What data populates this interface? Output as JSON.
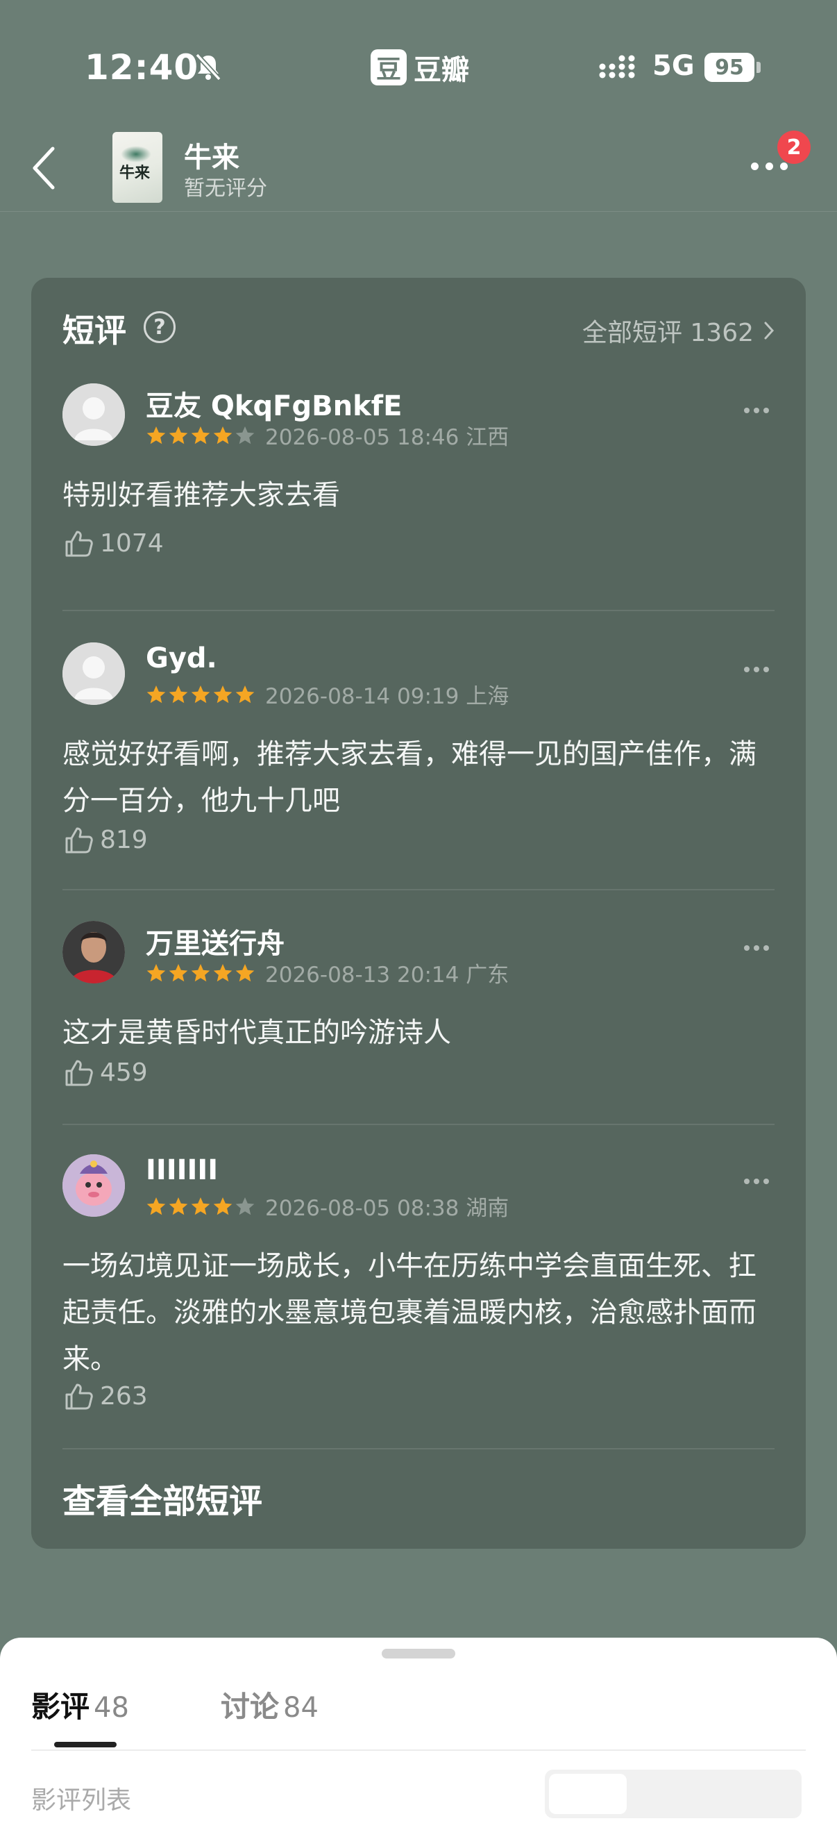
{
  "status_bar": {
    "time": "12:40",
    "network": "5G",
    "battery": "95",
    "app_logo": "豆",
    "app_name": "豆瓣"
  },
  "header": {
    "title": "牛来",
    "rating": "暂无评分",
    "notification_count": "2",
    "poster_text": "牛来"
  },
  "card": {
    "title": "短评",
    "help_symbol": "?",
    "all_link": "全部短评 1362",
    "view_all": "查看全部短评"
  },
  "reviews": [
    {
      "user": "豆友 QkqFgBnkfE",
      "stars": 4,
      "date": "2026-08-05 18:46 江西",
      "content": "特别好看推荐大家去看",
      "likes": "1074",
      "avatar": "default"
    },
    {
      "user": "Gyd.",
      "stars": 5,
      "date": "2026-08-14 09:19 上海",
      "content": "感觉好好看啊，推荐大家去看，难得一见的国产佳作，满分一百分，他九十几吧",
      "likes": "819",
      "avatar": "default"
    },
    {
      "user": "万里送行舟",
      "stars": 5,
      "date": "2026-08-13 20:14 广东",
      "content": "这才是黄昏时代真正的吟游诗人",
      "likes": "459",
      "avatar": "photo"
    },
    {
      "user": "IIIIIII",
      "stars": 4,
      "date": "2026-08-05 08:38 湖南",
      "content": "一场幻境见证一场成长，小牛在历练中学会直面生死、扛起责任。淡雅的水墨意境包裹着温暖内核，治愈感扑面而来。",
      "likes": "263",
      "avatar": "cartoon"
    }
  ],
  "bottom_sheet": {
    "tabs": [
      {
        "label": "影评",
        "count": "48"
      },
      {
        "label": "讨论",
        "count": "84"
      }
    ],
    "list_label": "影评列表"
  },
  "colors": {
    "background": "#6b7e75",
    "card": "#56665e",
    "star": "#f5a623",
    "star_empty": "#8a9690",
    "badge": "#f0474e"
  }
}
